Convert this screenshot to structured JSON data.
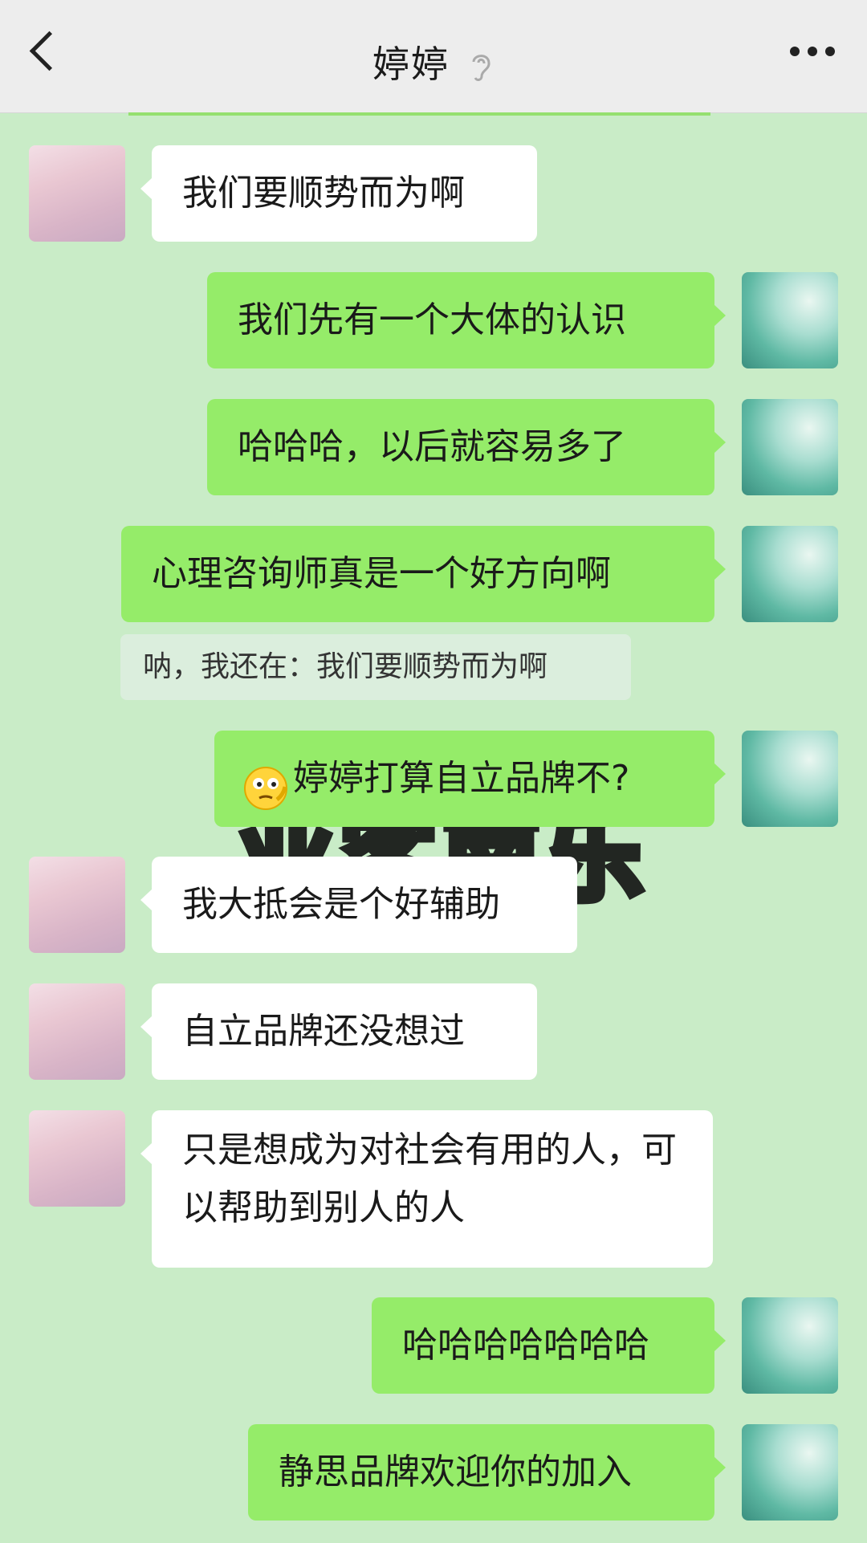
{
  "header": {
    "title": "婷婷",
    "back_icon": "chevron-left-icon",
    "ear_icon": "ear-icon",
    "more_icon": "more-dots-icon"
  },
  "background_text": "业客南乐",
  "messages": [
    {
      "side": "left",
      "text": "我们要顺势而为啊"
    },
    {
      "side": "right",
      "text": "我们先有一个大体的认识"
    },
    {
      "side": "right",
      "text": "哈哈哈，以后就容易多了"
    },
    {
      "side": "right",
      "text": "心理咨询师真是一个好方向啊"
    },
    {
      "side": "quote",
      "text": "呐，我还在：我们要顺势而为啊"
    },
    {
      "side": "right",
      "text": "婷婷打算自立品牌不?"
    },
    {
      "side": "left",
      "text": "我大抵会是个好辅助"
    },
    {
      "side": "left",
      "text": "自立品牌还没想过"
    },
    {
      "side": "left",
      "text": "只是想成为对社会有用的人，可以帮助到别人的人"
    },
    {
      "side": "right",
      "text": "哈哈哈哈哈哈哈"
    },
    {
      "side": "right",
      "text": "静思品牌欢迎你的加入"
    }
  ],
  "colors": {
    "chat_bg": "#c9ecc7",
    "sent_bubble": "#95ec69",
    "received_bubble": "#ffffff",
    "header_bg": "#ededed"
  }
}
